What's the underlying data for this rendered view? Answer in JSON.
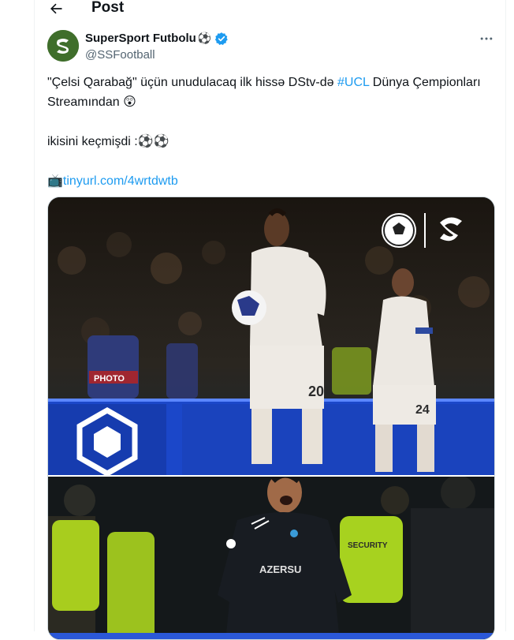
{
  "header": {
    "title": "Post"
  },
  "author": {
    "name": "SuperSport Futbolu",
    "name_emoji": "⚽",
    "handle": "@SSFootball",
    "verified": true
  },
  "tweet": {
    "line1_before": "\"Çelsi Qarabağ\" üçün unudulacaq ilk hissə DStv-də ",
    "hashtag": "#UCL",
    "line1_after": " Dünya Çempionları Streamından ",
    "line1_emoji": "😲",
    "line2": "ikisini keçmişdi :",
    "line2_emoji": "⚽⚽",
    "link_emoji": "📺",
    "link": "tinyurl.com/4wrtdwtb"
  },
  "media": {
    "photo1": {
      "shirt_left": "20",
      "shirt_right": "24",
      "banner_text": "PHOTO"
    },
    "photo2": {
      "shirt_sponsor": "AZERSU",
      "banner_text": "SECURITY"
    }
  },
  "colors": {
    "accent": "#1d9bf0",
    "verified": "#1d9bf0",
    "secondary_text": "#536471",
    "border": "#eff3f4"
  },
  "icons": {
    "back": "arrow-left-icon",
    "more": "more-dots-icon",
    "verified": "verified-badge-icon",
    "avatar": "supersport-logo-icon"
  }
}
